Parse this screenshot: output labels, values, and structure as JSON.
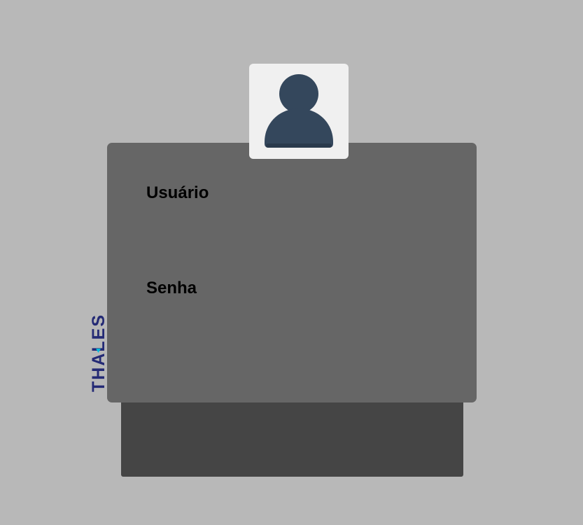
{
  "login": {
    "username_label": "Usuário",
    "password_label": "Senha"
  },
  "brand": {
    "name": "THALES",
    "color": "#242a75",
    "accent": "#00bbdd"
  },
  "avatar": {
    "icon": "user-icon",
    "color": "#34475c"
  },
  "colors": {
    "background": "#b8b8b8",
    "card": "#666666",
    "lower_panel": "#454545",
    "avatar_box": "#f0f0f0"
  }
}
